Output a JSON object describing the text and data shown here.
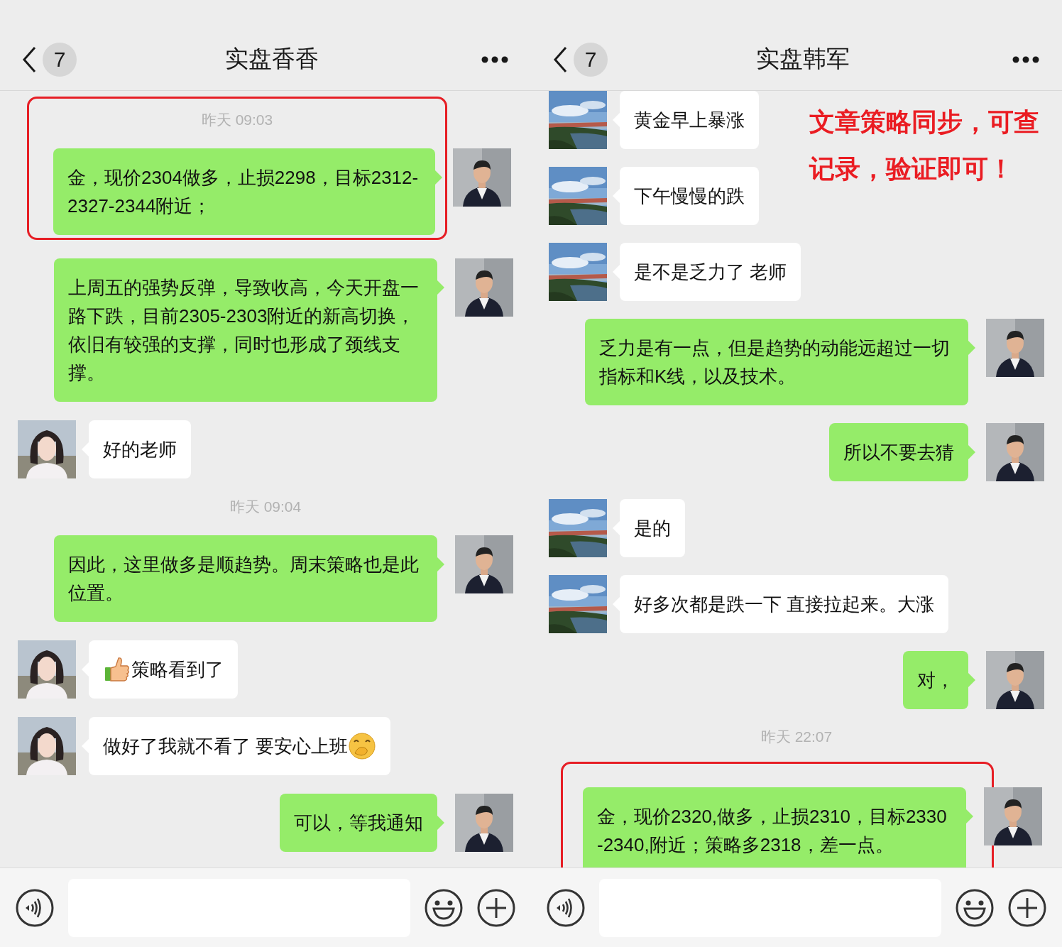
{
  "panels": [
    {
      "header": {
        "badge": "7",
        "title": "实盘香香"
      },
      "messages": [
        {
          "kind": "highlight",
          "items": [
            {
              "kind": "time",
              "text": "昨天 09:03"
            },
            {
              "kind": "out",
              "text": "金，现价2304做多，止损2298，目标2312-2327-2344附近；"
            }
          ]
        },
        {
          "kind": "out",
          "text": "上周五的强势反弹，导致收高，今天开盘一路下跌，目前2305-2303附近的新高切换，依旧有较强的支撑，同时也形成了颈线支撑。"
        },
        {
          "kind": "in",
          "text": "好的老师"
        },
        {
          "kind": "time",
          "text": "昨天 09:04"
        },
        {
          "kind": "out",
          "text": "因此，这里做多是顺趋势。周末策略也是此位置。"
        },
        {
          "kind": "in",
          "text": "策略看到了",
          "leading_icon": true
        },
        {
          "kind": "in",
          "text": "做好了我就不看了 要安心上班",
          "trailing_icon": true
        },
        {
          "kind": "out",
          "text": "可以，等我通知"
        }
      ]
    },
    {
      "header": {
        "badge": "7",
        "title": "实盘韩军"
      },
      "annotation": [
        "文章策略同步，可查",
        "记录，验证即可！"
      ],
      "messages": [
        {
          "kind": "in",
          "text": "黄金早上暴涨"
        },
        {
          "kind": "in",
          "text": "下午慢慢的跌"
        },
        {
          "kind": "in",
          "text": "是不是乏力了 老师"
        },
        {
          "kind": "out",
          "text": "乏力是有一点，但是趋势的动能远超过一切指标和K线，以及技术。"
        },
        {
          "kind": "out",
          "text": "所以不要去猜"
        },
        {
          "kind": "in",
          "text": "是的"
        },
        {
          "kind": "in",
          "text": "好多次都是跌一下 直接拉起来。大涨"
        },
        {
          "kind": "out",
          "text": "对，"
        },
        {
          "kind": "time",
          "text": "昨天 22:07"
        },
        {
          "kind": "highlight",
          "items": [
            {
              "kind": "out",
              "text": "金，现价2320,做多，止损2310，目标2330-2340,附近；策略多2318，差一点。"
            }
          ]
        }
      ]
    }
  ]
}
